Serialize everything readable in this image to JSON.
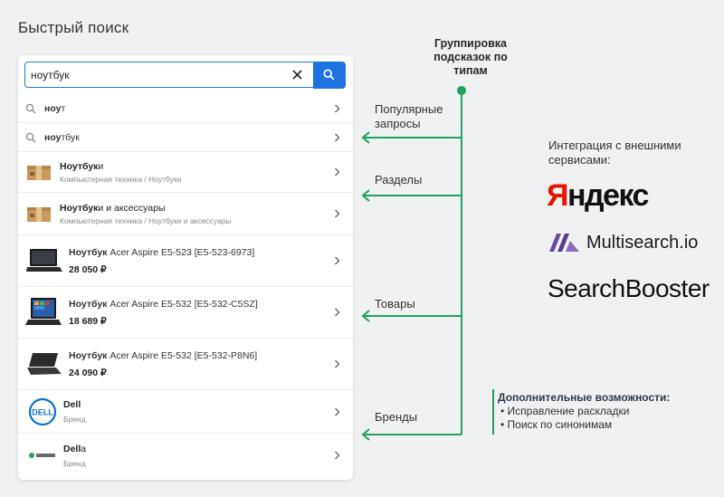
{
  "page_title": "Быстрый поиск",
  "search": {
    "value": "ноутбук"
  },
  "queries": [
    {
      "bold": "ноу",
      "rest": "т"
    },
    {
      "bold": "ноу",
      "rest": "тбук"
    }
  ],
  "categories": [
    {
      "bold": "Ноутбук",
      "rest": "и",
      "path": "Компьютерная техника  /  Ноутбуки"
    },
    {
      "bold": "Ноутбук",
      "rest": "и и аксессуары",
      "path": "Компьютерная техника  /  Ноутбуки и аксессуары"
    }
  ],
  "products": [
    {
      "bold": "Ноутбук",
      "rest": " Acer Aspire E5-523 [E5-523-6973]",
      "price": "28 050 ₽"
    },
    {
      "bold": "Ноутбук",
      "rest": " Acer Aspire E5-532 [E5-532-C5SZ]",
      "price": "18 689 ₽"
    },
    {
      "bold": "Ноутбук",
      "rest": " Acer Aspire E5-532 [E5-532-P8N6]",
      "price": "24 090 ₽"
    }
  ],
  "brands": [
    {
      "bold": "Dell",
      "rest": "",
      "sub": "Бренд",
      "logo_text": "DELL"
    },
    {
      "bold": "Dell",
      "rest": "a",
      "sub": "Бренд"
    }
  ],
  "annotations": {
    "group_title": "Группировка подсказок по типам",
    "popular": "Популярные запросы",
    "sections": "Разделы",
    "products": "Товары",
    "brands": "Бренды",
    "integration_title": "Интеграция с внешними сервисами:",
    "extra_title": "Дополнительные возможности:",
    "extra_items": [
      "• Исправление   раскладки",
      "• Поиск по синонимам"
    ]
  },
  "logos": {
    "yandex_first": "Я",
    "yandex_rest": "ндекс",
    "multisearch": "Multisearch.io",
    "searchbooster": "SearchBooster"
  },
  "colors": {
    "accent": "#1e73e0",
    "green": "#1fa35b",
    "yandex_red": "#e61400",
    "multisearch_purple": "#5a3c8c"
  }
}
